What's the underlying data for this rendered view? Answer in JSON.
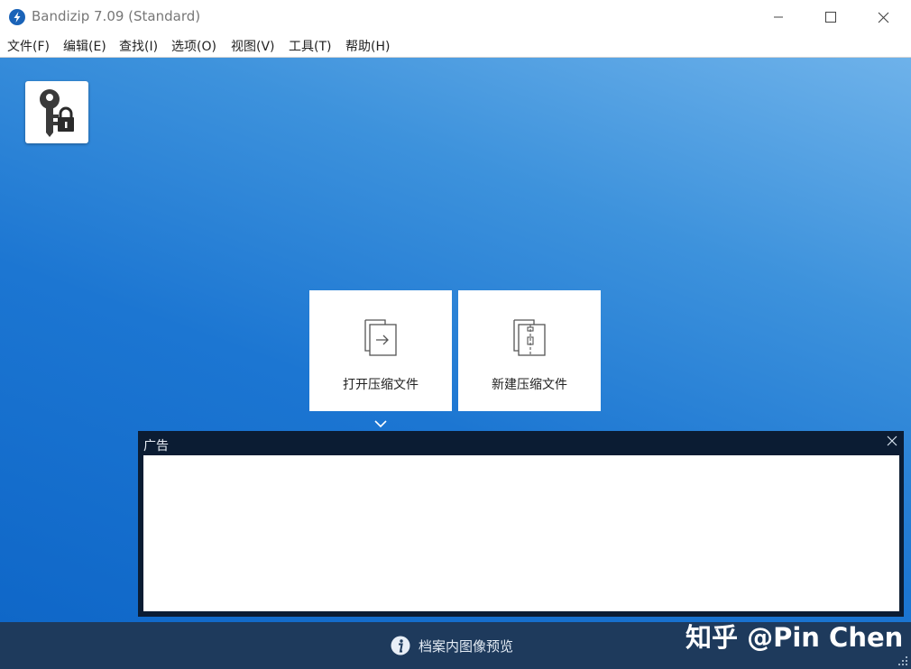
{
  "window": {
    "title": "Bandizip 7.09 (Standard)",
    "controls": [
      "minimize",
      "maximize",
      "close"
    ]
  },
  "menu": {
    "items": [
      {
        "label": "文件(F)"
      },
      {
        "label": "编辑(E)"
      },
      {
        "label": "查找(I)"
      },
      {
        "label": "选项(O)"
      },
      {
        "label": "视图(V)"
      },
      {
        "label": "工具(T)"
      },
      {
        "label": "帮助(H)"
      }
    ]
  },
  "main": {
    "password_tool_icon": "key-lock-icon",
    "tiles": [
      {
        "label": "打开压缩文件",
        "icon": "open-archive-icon"
      },
      {
        "label": "新建压缩文件",
        "icon": "new-archive-icon"
      }
    ]
  },
  "ad": {
    "title": "广告"
  },
  "bottom": {
    "text": "档案内图像预览",
    "watermark": "知乎 @Pin Chen"
  },
  "colors": {
    "accent": "#1c76d2",
    "bottom_bar": "#1e3a5c",
    "ad_frame": "#0b1c33"
  }
}
